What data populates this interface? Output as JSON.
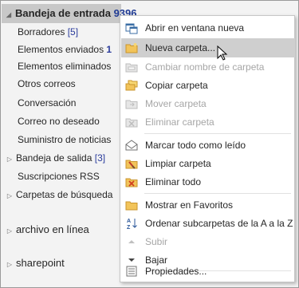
{
  "folders": {
    "inbox": {
      "label": "Bandeja de entrada",
      "count": "9396"
    },
    "items": [
      {
        "label": "Borradores",
        "count": "[5]"
      },
      {
        "label": "Elementos enviados",
        "count": "1"
      },
      {
        "label": "Elementos eliminados",
        "count": ""
      },
      {
        "label": "Otros correos",
        "count": ""
      },
      {
        "label": "Conversación",
        "count": ""
      },
      {
        "label": "Correo no deseado",
        "count": ""
      },
      {
        "label": "Suministro de noticias",
        "count": ""
      },
      {
        "label": "Bandeja de salida",
        "count": "[3]"
      },
      {
        "label": "Suscripciones RSS",
        "count": ""
      },
      {
        "label": "Carpetas de búsqueda",
        "count": ""
      }
    ],
    "archive": {
      "label": "archivo en línea"
    },
    "sharepoint": {
      "label": "sharepoint"
    }
  },
  "context_menu": {
    "items": [
      {
        "label": "Abrir en ventana nueva",
        "icon": "open-window-icon",
        "enabled": true
      },
      {
        "label": "Nueva carpeta...",
        "icon": "new-folder-icon",
        "enabled": true,
        "hover": true
      },
      {
        "label": "Cambiar nombre de carpeta",
        "icon": "rename-folder-icon",
        "enabled": false
      },
      {
        "label": "Copiar carpeta",
        "icon": "copy-folder-icon",
        "enabled": true
      },
      {
        "label": "Mover carpeta",
        "icon": "move-folder-icon",
        "enabled": false
      },
      {
        "label": "Eliminar carpeta",
        "icon": "delete-folder-icon",
        "enabled": false
      },
      {
        "label": "Marcar todo como leído",
        "icon": "mark-read-icon",
        "enabled": true
      },
      {
        "label": "Limpiar carpeta",
        "icon": "clean-folder-icon",
        "enabled": true
      },
      {
        "label": "Eliminar todo",
        "icon": "delete-all-icon",
        "enabled": true
      },
      {
        "label": "Mostrar en Favoritos",
        "icon": "favorites-icon",
        "enabled": true
      },
      {
        "label": "Ordenar subcarpetas de la A a la Z",
        "icon": "sort-az-icon",
        "enabled": true
      },
      {
        "label": "Subir",
        "icon": "move-up-icon",
        "enabled": false
      },
      {
        "label": "Bajar",
        "icon": "move-down-icon",
        "enabled": true
      },
      {
        "label": "Propiedades...",
        "icon": "properties-icon",
        "enabled": true
      }
    ]
  }
}
